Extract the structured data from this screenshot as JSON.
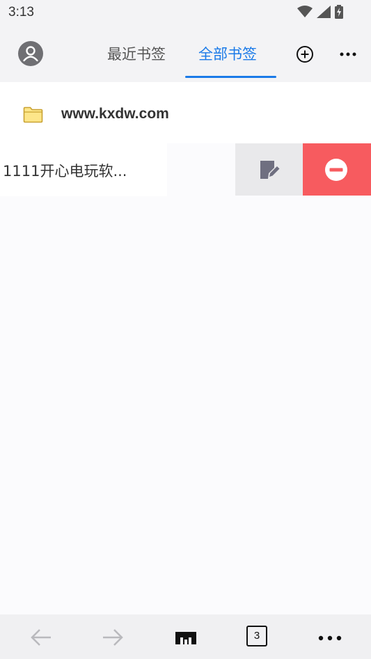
{
  "status_bar": {
    "time": "3:13",
    "icons": [
      "wifi-icon",
      "cell-signal-icon",
      "battery-charging-icon"
    ]
  },
  "header": {
    "tabs": [
      {
        "label": "最近书签",
        "active": false
      },
      {
        "label": "全部书签",
        "active": true
      }
    ],
    "accent_color": "#1a7ae8",
    "icons": [
      "avatar-icon",
      "add-circle-icon",
      "more-horizontal-icon"
    ]
  },
  "bookmarks": {
    "folder": {
      "label": "www.kxdw.com",
      "icon": "folder-icon"
    },
    "items": [
      {
        "title": "1111开心电玩软..."
      }
    ],
    "swipe_actions": {
      "edit_icon": "edit-note-icon",
      "delete_icon": "remove-circle-icon",
      "delete_color": "#f75b5f"
    }
  },
  "bottom_bar": {
    "tab_count": "3",
    "icons": [
      "back-arrow-icon",
      "forward-arrow-icon",
      "home-icon",
      "tabs-icon",
      "menu-dots-icon"
    ]
  }
}
